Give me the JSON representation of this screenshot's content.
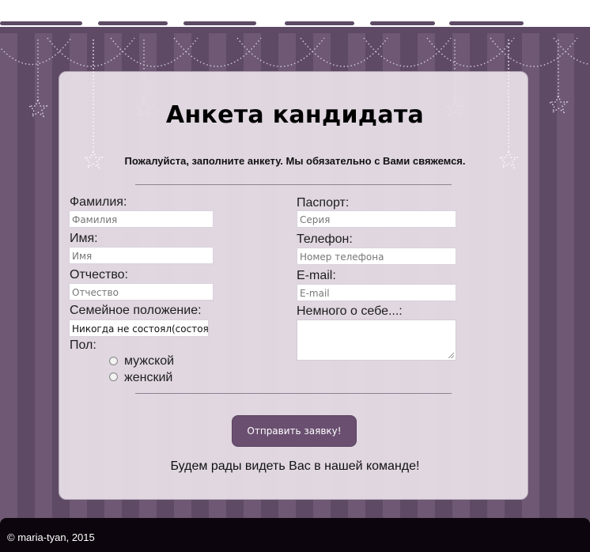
{
  "page": {
    "title": "Анкета кандидата",
    "subtitle": "Пожалуйста, заполните анкету. Мы обязательно с Вами свяжемся."
  },
  "form": {
    "left": {
      "surname_label": "Фамилия:",
      "surname_placeholder": "Фамилия",
      "name_label": "Имя:",
      "name_placeholder": "Имя",
      "patronymic_label": "Отчество:",
      "patronymic_placeholder": "Отчество",
      "marital_label": "Семейное положение:",
      "marital_value": "Никогда не состоял(состояла",
      "gender_label": "Пол:",
      "gender_options": [
        "мужской",
        "женский"
      ]
    },
    "right": {
      "passport_label": "Паспорт:",
      "passport_placeholder": "Серия",
      "phone_label": "Телефон:",
      "phone_placeholder": "Номер телефона",
      "email_label": "E-mail:",
      "email_placeholder": "E-mail",
      "about_label": "Немного о себе...:"
    },
    "submit_label": "Отправить заявку!"
  },
  "closing_message": "Будем рады видеть Вас в нашей команде!",
  "footer": {
    "copyright": "© maria-tyan, 2015"
  },
  "colors": {
    "background": "#6b5671",
    "accent": "#6a4f70",
    "card": "#e8e1e9",
    "footer": "#0c050d"
  }
}
